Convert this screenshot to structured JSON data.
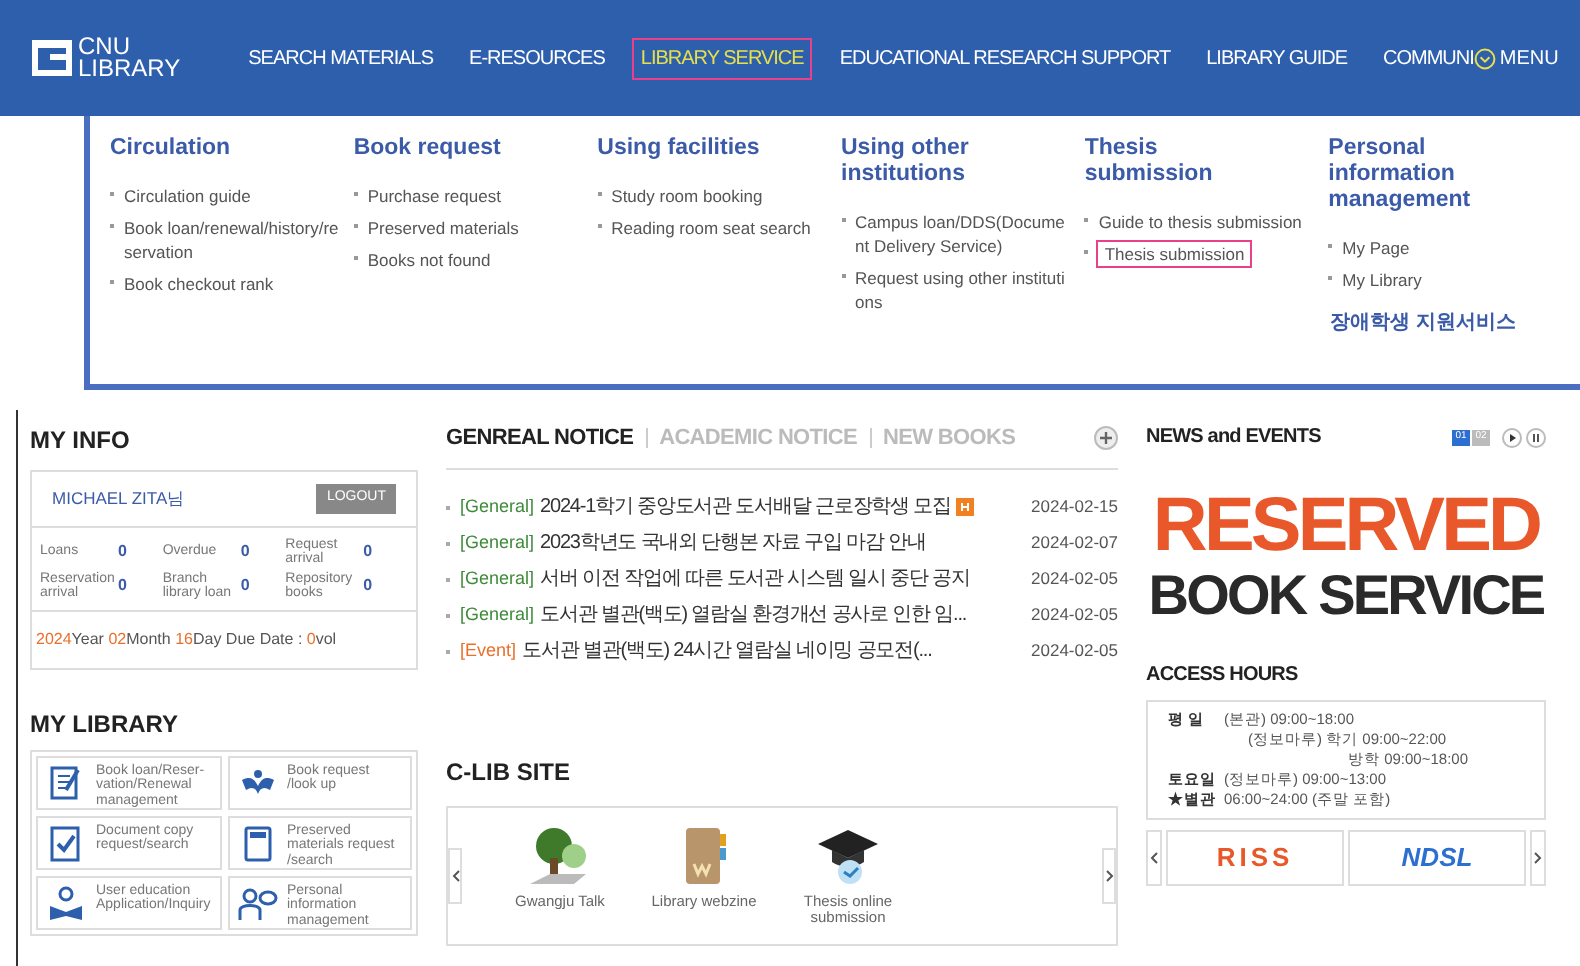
{
  "header": {
    "logo": [
      "CNU",
      "LIBRARY"
    ],
    "nav": [
      {
        "label": "SEARCH MATERIALS",
        "selected": false
      },
      {
        "label": "E-RESOURCES",
        "selected": false
      },
      {
        "label": "LIBRARY SERVICE",
        "selected": true
      },
      {
        "label": "EDUCATIONAL RESEARCH SUPPORT",
        "selected": false
      },
      {
        "label": "LIBRARY GUIDE",
        "selected": false
      },
      {
        "label": "COMMUNI",
        "selected": false
      }
    ],
    "menu_button": "MENU"
  },
  "mega_menu": [
    {
      "title": "Circulation",
      "items": [
        {
          "kind": "item",
          "label": "Circulation guide",
          "highlighted": false
        },
        {
          "kind": "item",
          "label": "Book loan/renewal/history/reservation",
          "highlighted": false
        },
        {
          "kind": "item",
          "label": "Book checkout rank",
          "highlighted": false
        }
      ]
    },
    {
      "title": "Book request",
      "items": [
        {
          "kind": "item",
          "label": "Purchase request",
          "highlighted": false
        },
        {
          "kind": "item",
          "label": "Preserved materials",
          "highlighted": false
        },
        {
          "kind": "item",
          "label": "Books not found",
          "highlighted": false
        }
      ]
    },
    {
      "title": "Using facilities",
      "items": [
        {
          "kind": "item",
          "label": "Study room booking",
          "highlighted": false
        },
        {
          "kind": "item",
          "label": "Reading room seat search",
          "highlighted": false
        }
      ]
    },
    {
      "title": "Using other institutions",
      "items": [
        {
          "kind": "item",
          "label": "Campus loan/DDS(Document Delivery Service)",
          "highlighted": false
        },
        {
          "kind": "item",
          "label": "Request using other institutions",
          "highlighted": false
        }
      ]
    },
    {
      "title": "Thesis submission",
      "items": [
        {
          "kind": "item",
          "label": "Guide to thesis submission",
          "highlighted": false
        },
        {
          "kind": "item",
          "label": "Thesis submission",
          "highlighted": true
        }
      ]
    },
    {
      "title": "Personal information management",
      "items": [
        {
          "kind": "item",
          "label": "My Page",
          "highlighted": false
        },
        {
          "kind": "item",
          "label": "My Library",
          "highlighted": false
        },
        {
          "kind": "link",
          "label": "장애학생 지원서비스",
          "highlighted": false
        }
      ]
    }
  ],
  "my_info": {
    "title": "MY INFO",
    "user": "MICHAEL ZITA님",
    "logout": "LOGOUT",
    "stats": [
      {
        "label": "Loans",
        "value": "0"
      },
      {
        "label": "Overdue",
        "value": "0"
      },
      {
        "label": "Request arrival",
        "value": "0"
      },
      {
        "label": "Reservation arrival",
        "value": "0"
      },
      {
        "label": "Branch library loan",
        "value": "0"
      },
      {
        "label": "Repository books",
        "value": "0"
      }
    ],
    "due": [
      {
        "text": "2024",
        "accent": true
      },
      {
        "text": "Year ",
        "accent": false
      },
      {
        "text": "02",
        "accent": true
      },
      {
        "text": "Month ",
        "accent": false
      },
      {
        "text": "16",
        "accent": true
      },
      {
        "text": "Day Due Date : ",
        "accent": false
      },
      {
        "text": "0",
        "accent": true
      },
      {
        "text": "vol",
        "accent": false
      }
    ]
  },
  "notices": {
    "tabs": [
      {
        "label": "GENREAL NOTICE",
        "selected": true
      },
      {
        "label": "ACADEMIC NOTICE",
        "selected": false
      },
      {
        "label": "NEW BOOKS",
        "selected": false
      }
    ],
    "rows": [
      {
        "category": "[General]",
        "color": "#3f8a3a",
        "title": "2024-1학기 중앙도서관 도서배달 근로장학생 모집",
        "new": true,
        "date": "2024-02-15"
      },
      {
        "category": "[General]",
        "color": "#3f8a3a",
        "title": "2023학년도 국내외 단행본 자료 구입 마감 안내",
        "new": false,
        "date": "2024-02-07"
      },
      {
        "category": "[General]",
        "color": "#3f8a3a",
        "title": "서버 이전 작업에 따른 도서관 시스템 일시 중단 공지",
        "new": false,
        "date": "2024-02-05"
      },
      {
        "category": "[General]",
        "color": "#3f8a3a",
        "title": "도서관 별관(백도) 열람실 환경개선 공사로 인한 임...",
        "new": false,
        "date": "2024-02-05"
      },
      {
        "category": "[Event]",
        "color": "#e8702a",
        "title": "도서관 별관(백도) 24시간 열람실 네이밍 공모전(...",
        "new": false,
        "date": "2024-02-05"
      }
    ]
  },
  "news": {
    "title": "NEWS and EVENTS",
    "pages": [
      {
        "label": "01",
        "selected": true
      },
      {
        "label": "02",
        "selected": false
      }
    ],
    "banner": [
      "RESERVED",
      "BOOK SERVICE"
    ]
  },
  "my_library": {
    "title": "MY LIBRARY",
    "tiles": [
      "Book loan/Reser-vation/Renewal management",
      "Book request /look up",
      "Document copy request/search",
      "Preserved materials request /search",
      "User education Application/Inquiry",
      "Personal information management"
    ]
  },
  "clib": {
    "title": "C-LIB SITE",
    "items": [
      "Gwangju Talk",
      "Library webzine",
      "Thesis online submission"
    ]
  },
  "access_hours": {
    "title": "ACCESS HOURS",
    "lines": [
      {
        "kind": "labeled",
        "label": "평 일",
        "value": "(본관) 09:00~18:00"
      },
      {
        "kind": "continued",
        "value": "(정보마루) 학기 09:00~22:00"
      },
      {
        "kind": "sub",
        "value": "방학 09:00~18:00"
      },
      {
        "kind": "labeled",
        "label": "토요일",
        "value": "(정보마루) 09:00~13:00"
      },
      {
        "kind": "labeled",
        "label": "★별관",
        "value": "06:00~24:00 (주말 포함)"
      }
    ]
  },
  "site_links": [
    "RISS",
    "NDSL"
  ]
}
